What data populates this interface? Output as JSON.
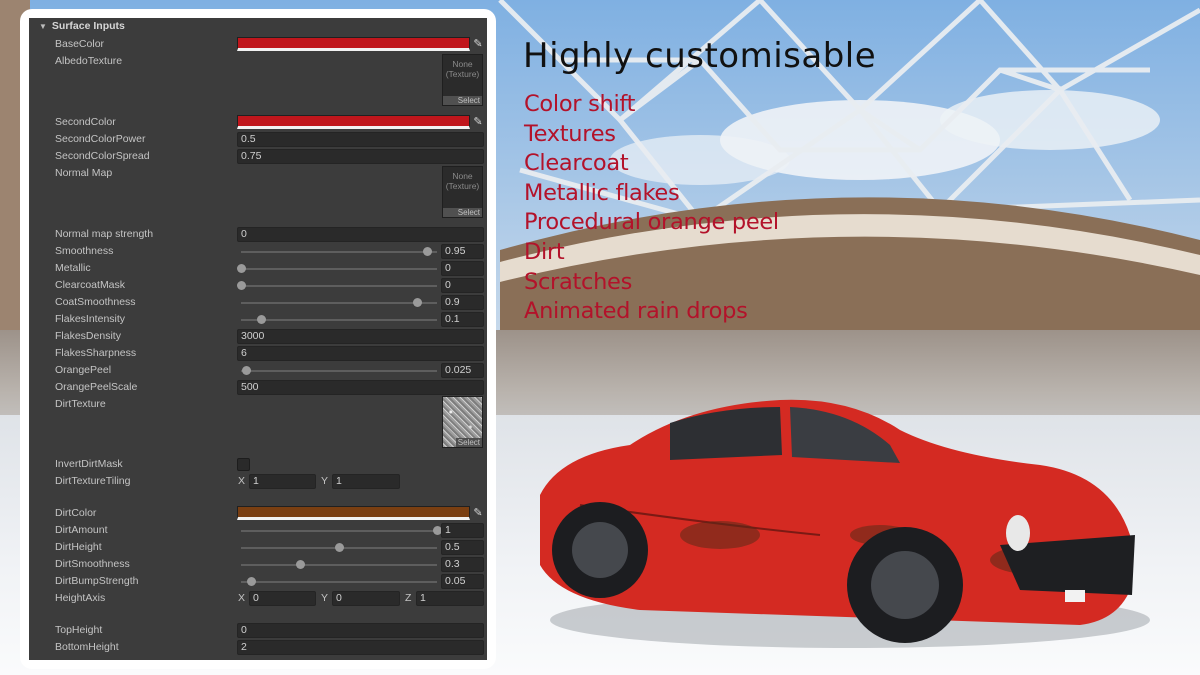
{
  "headline": "Highly customisable",
  "features": [
    "Color shift",
    "Textures",
    "Clearcoat",
    "Metallic flakes",
    "Procedural orange peel",
    "Dirt",
    "Scratches",
    "Animated rain drops"
  ],
  "inspector": {
    "section_title": "Surface Inputs",
    "texture_none": "None\n(Texture)",
    "texture_none_line1": "None",
    "texture_none_line2": "(Texture)",
    "select_label": "Select",
    "labels": {
      "base_color": "BaseColor",
      "albedo_texture": "AlbedoTexture",
      "second_color": "SecondColor",
      "second_color_power": "SecondColorPower",
      "second_color_spread": "SecondColorSpread",
      "normal_map": "Normal Map",
      "normal_map_strength": "Normal map strength",
      "smoothness": "Smoothness",
      "metallic": "Metallic",
      "clearcoat_mask": "ClearcoatMask",
      "coat_smoothness": "CoatSmoothness",
      "flakes_intensity": "FlakesIntensity",
      "flakes_density": "FlakesDensity",
      "flakes_sharpness": "FlakesSharpness",
      "orange_peel": "OrangePeel",
      "orange_peel_scale": "OrangePeelScale",
      "dirt_texture": "DirtTexture",
      "invert_dirt_mask": "InvertDirtMask",
      "dirt_texture_tiling": "DirtTextureTiling",
      "dirt_color": "DirtColor",
      "dirt_amount": "DirtAmount",
      "dirt_height": "DirtHeight",
      "dirt_smoothness": "DirtSmoothness",
      "dirt_bump_strength": "DirtBumpStrength",
      "height_axis": "HeightAxis",
      "top_height": "TopHeight",
      "bottom_height": "BottomHeight"
    },
    "values": {
      "base_color_hex": "#c0161c",
      "second_color_hex": "#c0161c",
      "dirt_color_hex": "#7a3f12",
      "second_color_power": "0.5",
      "second_color_spread": "0.75",
      "normal_map_strength": "0",
      "smoothness": "0.95",
      "metallic": "0",
      "clearcoat_mask": "0",
      "coat_smoothness": "0.9",
      "flakes_intensity": "0.1",
      "flakes_density": "3000",
      "flakes_sharpness": "6",
      "orange_peel": "0.025",
      "orange_peel_scale": "500",
      "invert_dirt_mask": false,
      "dirt_texture_tiling_x": "1",
      "dirt_texture_tiling_y": "1",
      "dirt_amount": "1",
      "dirt_height": "0.5",
      "dirt_smoothness": "0.3",
      "dirt_bump_strength": "0.05",
      "height_axis_x": "0",
      "height_axis_y": "0",
      "height_axis_z": "1",
      "top_height": "0",
      "bottom_height": "2"
    },
    "slider_fraction": {
      "smoothness": 0.95,
      "metallic": 0,
      "clearcoat_mask": 0,
      "coat_smoothness": 0.9,
      "flakes_intensity": 0.1,
      "orange_peel": 0.025,
      "dirt_amount": 1,
      "dirt_height": 0.5,
      "dirt_smoothness": 0.3,
      "dirt_bump_strength": 0.05
    },
    "axis_letters": {
      "x": "X",
      "y": "Y",
      "z": "Z"
    }
  },
  "icons": {
    "eyedropper": "eyedropper-icon",
    "foldout": "foldout-triangle-icon"
  }
}
